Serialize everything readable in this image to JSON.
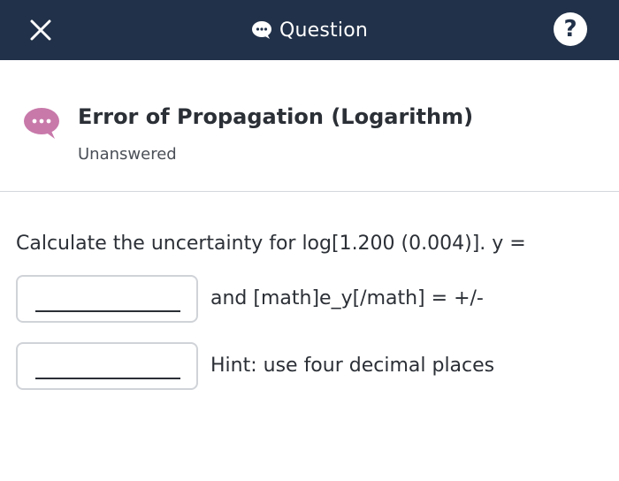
{
  "topbar": {
    "title": "Question",
    "close_icon": "close-icon",
    "chat_icon": "chat-bubble-icon",
    "help_icon": "help-icon",
    "help_glyph": "?",
    "background": "#213149"
  },
  "question": {
    "icon": "chat-bubble-icon",
    "icon_color": "#c879aa",
    "title": "Error of Propagation (Logarithm)",
    "status": "Unanswered"
  },
  "body": {
    "prompt": "Calculate the uncertainty for log[1.200 (0.004)]. y =",
    "answers": [
      {
        "value": "",
        "after_text": "and [math]e_y[/math] = +/-"
      },
      {
        "value": "",
        "after_text": "Hint: use four decimal places"
      }
    ]
  }
}
